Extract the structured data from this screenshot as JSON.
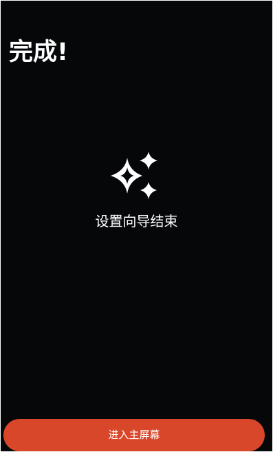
{
  "header": {
    "title": "完成!"
  },
  "main": {
    "icon": "sparkles-icon",
    "message": "设置向导结束"
  },
  "footer": {
    "enter_button_label": "进入主屏幕"
  },
  "colors": {
    "background": "#060709",
    "accent": "#d9472a",
    "text": "#ffffff"
  }
}
